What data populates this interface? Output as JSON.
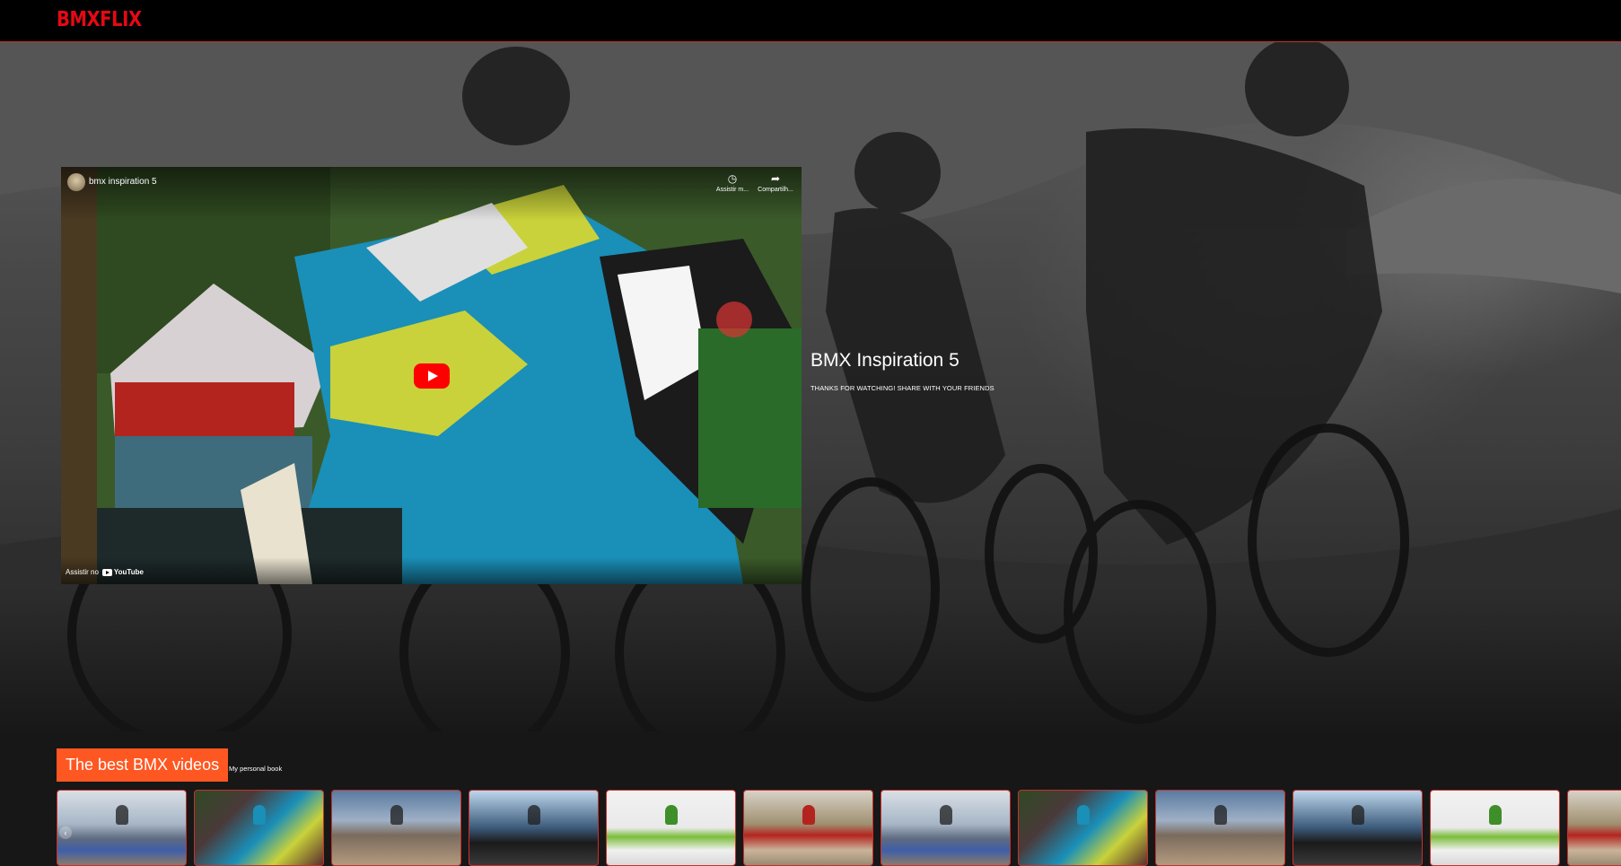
{
  "header": {
    "logo_text": "BMXFLIX"
  },
  "hero": {
    "title": "BMX Inspiration 5",
    "subtitle": "THANKS FOR WATCHING! SHARE WITH YOUR FRIENDS"
  },
  "player": {
    "channel_title": "bmx inspiration 5",
    "watch_later_label": "Assistir m...",
    "share_label": "Compartilh...",
    "watch_on_label": "Assistir no",
    "youtube_label": "YouTube",
    "icons": {
      "watch_later": "clock-icon",
      "share": "share-icon",
      "play": "play-icon"
    }
  },
  "section": {
    "title": "The best BMX videos",
    "subtitle": "My personal book",
    "accent_color": "#ff5722",
    "thumbnails": [
      {
        "style": "t-a",
        "rider": ""
      },
      {
        "style": "t-b",
        "rider": "b"
      },
      {
        "style": "t-c",
        "rider": ""
      },
      {
        "style": "t-d",
        "rider": ""
      },
      {
        "style": "t-e",
        "rider": "g"
      },
      {
        "style": "t-f",
        "rider": "r"
      },
      {
        "style": "t-a",
        "rider": ""
      },
      {
        "style": "t-b",
        "rider": "b"
      },
      {
        "style": "t-c",
        "rider": ""
      },
      {
        "style": "t-d",
        "rider": ""
      },
      {
        "style": "t-e",
        "rider": "g"
      },
      {
        "style": "t-f",
        "rider": "r"
      }
    ]
  },
  "colors": {
    "brand": "#e50914",
    "header_border": "#c9302c",
    "youtube_red": "#ff0000"
  }
}
